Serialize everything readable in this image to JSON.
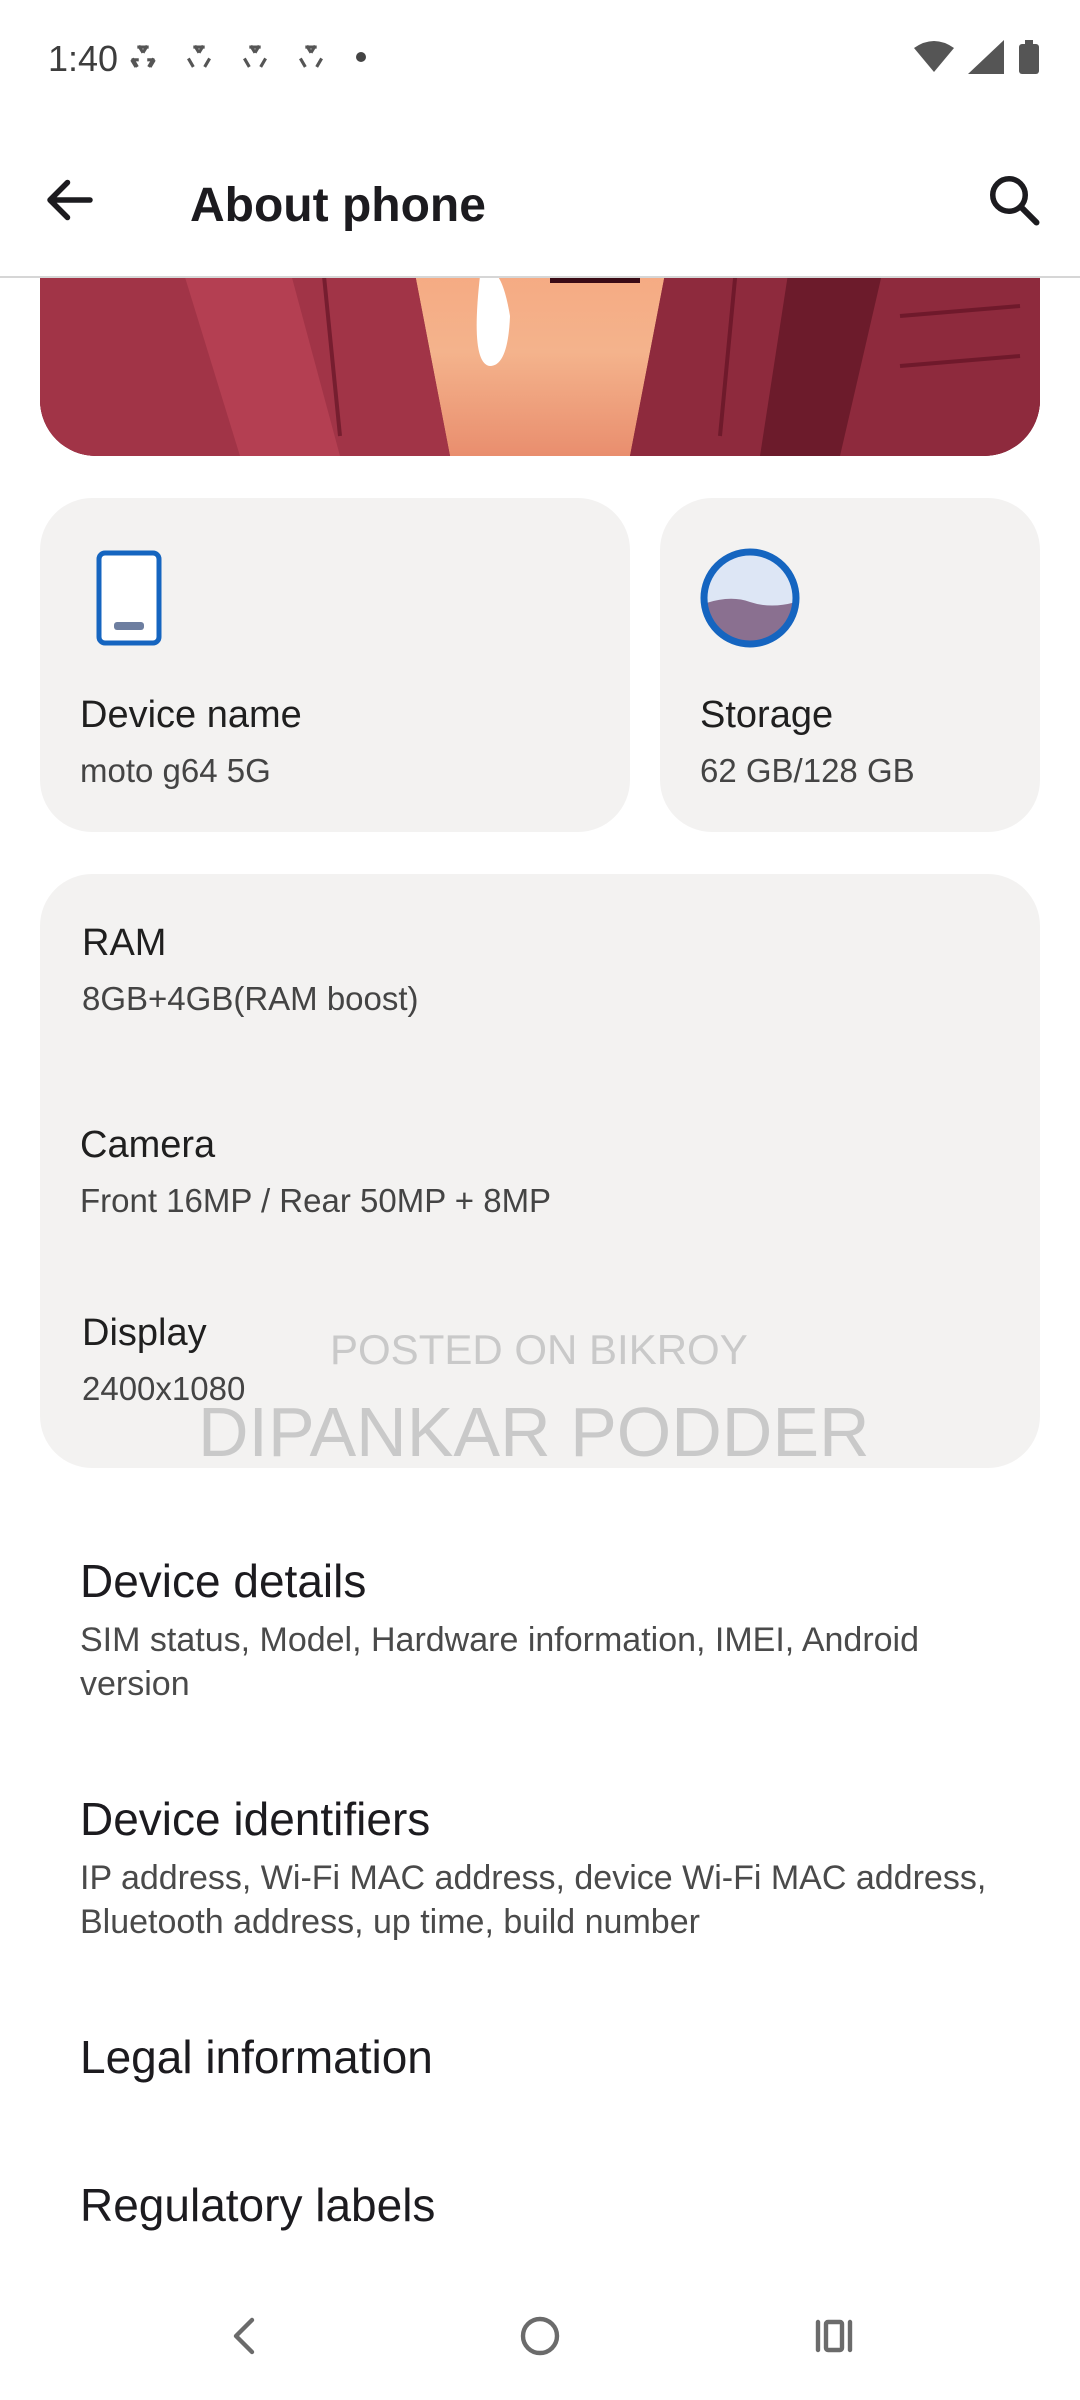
{
  "status_bar": {
    "time": "1:40",
    "notification_icons": [
      "notification-icon",
      "notification-icon",
      "notification-icon",
      "notification-icon"
    ],
    "system_icons": [
      "wifi-icon",
      "cellular-signal-icon",
      "battery-icon"
    ]
  },
  "app_bar": {
    "title": "About phone",
    "back_icon": "arrow-back-icon",
    "search_icon": "search-icon"
  },
  "cards": {
    "device_name": {
      "label": "Device name",
      "value": "moto g64 5G",
      "icon": "phone-icon"
    },
    "storage": {
      "label": "Storage",
      "value": "62 GB/128 GB",
      "icon": "storage-icon"
    }
  },
  "specs": [
    {
      "label": "RAM",
      "value": "8GB+4GB(RAM boost)"
    },
    {
      "label": "Camera",
      "value": "Front 16MP / Rear 50MP + 8MP"
    },
    {
      "label": "Display",
      "value": "2400x1080"
    }
  ],
  "list_items": [
    {
      "title": "Device details",
      "subtitle": "SIM status, Model, Hardware information, IMEI, Android version"
    },
    {
      "title": "Device identifiers",
      "subtitle": "IP address, Wi-Fi MAC address, device Wi-Fi MAC address, Bluetooth address, up time, build number"
    },
    {
      "title": "Legal information"
    },
    {
      "title": "Regulatory labels"
    }
  ],
  "watermark": {
    "line1": "POSTED ON BIKROY",
    "line2": "DIPANKAR PODDER"
  },
  "nav_bar": {
    "back_icon": "nav-back-icon",
    "home_icon": "nav-home-icon",
    "recents_icon": "nav-recents-icon"
  },
  "colors": {
    "card_background": "#f3f2f1",
    "accent_blue": "#1565c0",
    "hero_red": "#8a2a3e"
  }
}
